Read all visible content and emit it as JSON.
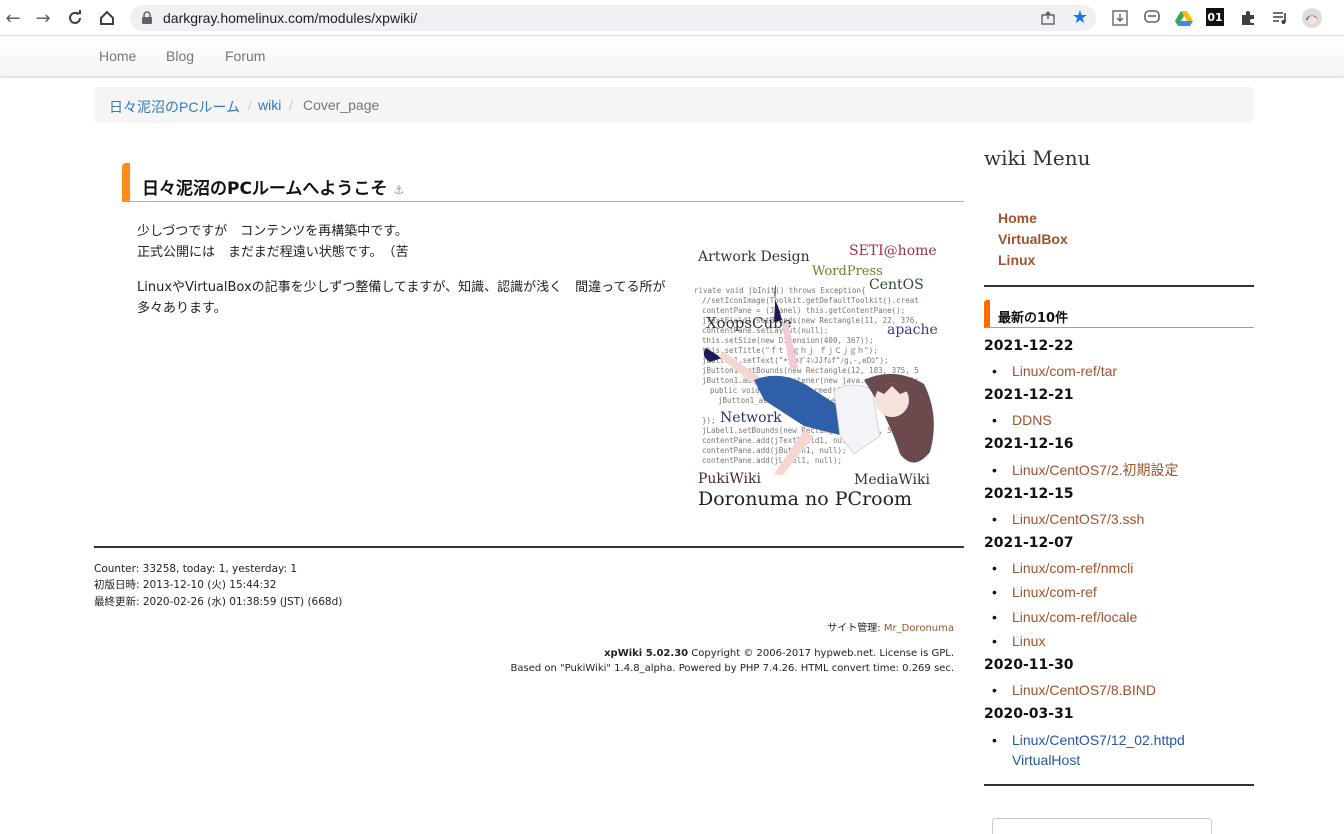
{
  "browser": {
    "url": "darkgray.homelinux.com/modules/xpwiki/",
    "ext_badge": "01"
  },
  "sitenav": {
    "items": [
      "Home",
      "Blog",
      "Forum"
    ]
  },
  "breadcrumb": {
    "items": [
      "日々泥沼のPCルーム",
      "wiki",
      "Cover_page"
    ],
    "separator": "/"
  },
  "main": {
    "heading": "日々泥沼のPCルームへようこそ",
    "anchor": "⚓",
    "lines": [
      "少しづつですが　コンテンツを再構築中です。",
      "正式公開には　まだまだ程遠い状態です。　（苦"
    ],
    "paragraph": "LinuxやVirtualBoxの記事を少しずつ整備してますが、知識、認識が浅く　間違ってる所が多々あります。",
    "artwork": {
      "words": [
        "Artwork Design",
        "SETI@home",
        "WordPress",
        "CentOS",
        "XoopsCube",
        "apache",
        "Network",
        "PukiWiki",
        "MediaWiki"
      ],
      "title": "Doronuma no PCroom"
    }
  },
  "footer": {
    "counter": "Counter: 33258, today: 1, yesterday: 1",
    "first": "初版日時: 2013-12-10 (火) 15:44:32",
    "updated": "最終更新: 2020-02-26 (水) 01:38:59 (JST) (668d)",
    "admin_label": "サイト管理: ",
    "admin_name": "Mr_Doronuma",
    "xpwiki": "xpWiki 5.02.30",
    "copyright": " Copyright © 2006-2017 hypweb.net. License is GPL.",
    "based": "Based on \"PukiWiki\" 1.4.8_alpha. Powered by PHP 7.4.26. HTML convert time: 0.269 sec."
  },
  "sidebar": {
    "menu_title": "wiki Menu",
    "menu": [
      "Home",
      "VirtualBox",
      "Linux"
    ],
    "recent_title": "最新の10件",
    "recent": [
      {
        "date": "2021-12-22",
        "items": [
          "Linux/com-ref/tar"
        ]
      },
      {
        "date": "2021-12-21",
        "items": [
          "DDNS"
        ]
      },
      {
        "date": "2021-12-16",
        "items": [
          "Linux/CentOS7/2.初期設定"
        ]
      },
      {
        "date": "2021-12-15",
        "items": [
          "Linux/CentOS7/3.ssh"
        ]
      },
      {
        "date": "2021-12-07",
        "items": [
          "Linux/com-ref/nmcli",
          "Linux/com-ref",
          "Linux/com-ref/locale",
          "Linux"
        ]
      },
      {
        "date": "2020-11-30",
        "items": [
          "Linux/CentOS7/8.BIND"
        ]
      },
      {
        "date": "2020-03-31",
        "items": [
          "Linux/CentOS7/12_02.httpd",
          "VirtualHost"
        ]
      }
    ]
  },
  "colors": {
    "accent": "#ff8c1a",
    "link": "#a0522d",
    "breadcrumb_link": "#337ab7"
  }
}
